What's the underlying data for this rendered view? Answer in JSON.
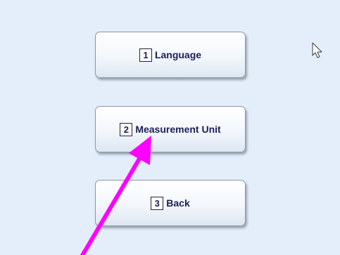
{
  "menu": {
    "items": [
      {
        "number": "1",
        "label": "Language"
      },
      {
        "number": "2",
        "label": "Measurement Unit"
      },
      {
        "number": "3",
        "label": "Back"
      }
    ]
  },
  "annotation": {
    "arrow_color": "#ff00ff",
    "arrow_target": "measurement-unit-button"
  },
  "cursor": {
    "icon": "mouse-pointer-icon"
  }
}
